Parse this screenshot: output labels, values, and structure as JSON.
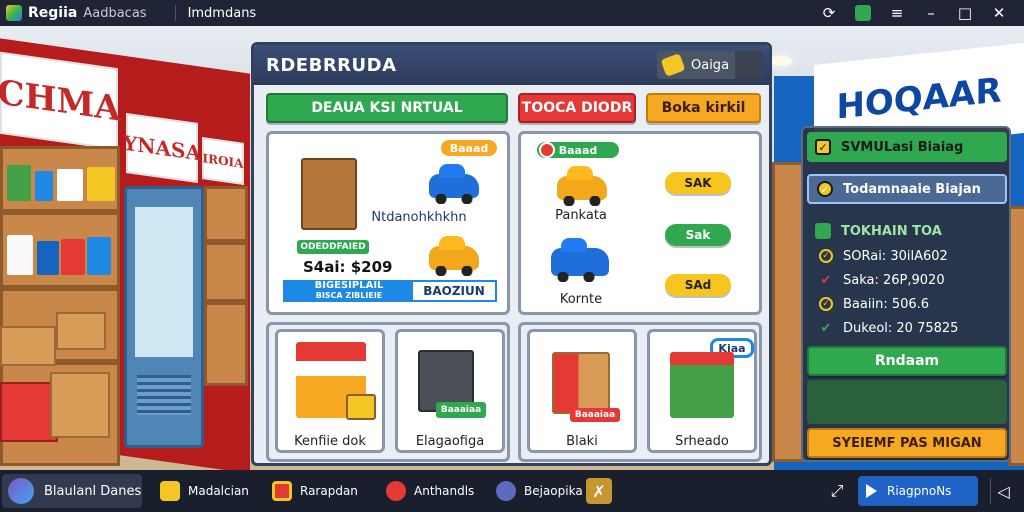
{
  "titlebar": {
    "app_name": "Regiia",
    "app_sub": "Aadbacas",
    "tab": "Imdmdans",
    "controls": [
      "refresh-icon",
      "app-icon",
      "menu-icon",
      "minimize-icon",
      "maximize-icon",
      "close-icon"
    ]
  },
  "scene": {
    "sign_left": "CHMA",
    "sign_mid": "YNASA",
    "sign_small": "IROIA",
    "sign_right": "HOQAAR"
  },
  "panel": {
    "title": "RDEBRRUDA",
    "coins_label": "Oaiga",
    "tabs": [
      "DEAUA KSI NRTUAL",
      "TOOCA DIODR",
      "Boka kirkil"
    ],
    "vehicles": {
      "left_card": {
        "badge": "Baaad",
        "caption": "Ntdanohkhkhn",
        "info_tag": "ODEDDFAIED",
        "price": "S4ai: $209",
        "price_box_left": "BIGESIPLAIL",
        "price_box_sub": "BISCA ZIBLIEIE",
        "price_box_right": "BAOZIUN"
      },
      "right_card": {
        "badge": "Baaad",
        "items": [
          {
            "name": "Pankata",
            "button": "SAK"
          },
          {
            "name": "",
            "button": "Sak"
          },
          {
            "name": "Kornte",
            "button": "SAd"
          }
        ]
      }
    },
    "products": [
      {
        "name": "Kenfiie dok",
        "tag": ""
      },
      {
        "name": "Elagaofiga",
        "tag": "Baaaiaa"
      },
      {
        "name": "Blaki",
        "tag": "Baaaiaa"
      },
      {
        "name": "Srheado",
        "tag": "Kiaa"
      }
    ]
  },
  "side": {
    "row1": "SVMULasi Biaiag",
    "row2": "Todamnaaie Biajan",
    "section_title": "TOKHAIN TOA",
    "stats": [
      {
        "icon": "circle-check-icon",
        "text": "SORai: 30ilA602",
        "color": "#f3c623"
      },
      {
        "icon": "red-check-icon",
        "text": "Saka: 26P,9020",
        "color": "#e53935"
      },
      {
        "icon": "circle-check-icon",
        "text": "Baaiin: 506.6",
        "color": "#f3c623"
      },
      {
        "icon": "green-check-icon",
        "text": "Dukeol: 20 75825",
        "color": "#2fa84f"
      }
    ],
    "button1": "Rndaam",
    "button2": "SYEIEMF PAS MIGAN"
  },
  "taskbar": {
    "start_label": "Blaulanl Danes",
    "items": [
      "Madalcian",
      "Rarapdan",
      "Anthandls",
      "Bejaopika"
    ],
    "play_label": "RiagpnoNs"
  }
}
